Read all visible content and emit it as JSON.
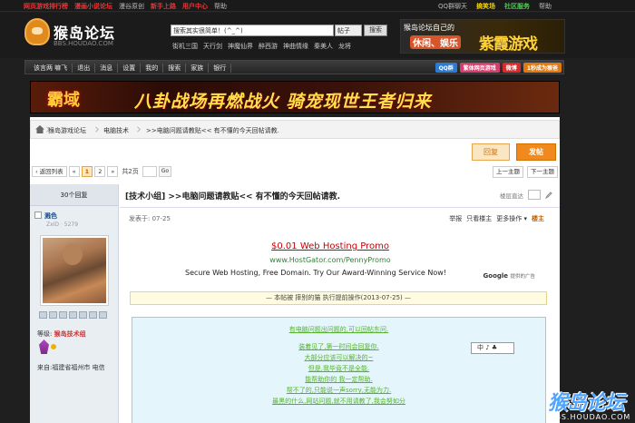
{
  "topbar": {
    "left": [
      "网页游戏排行榜",
      "漫画小说论坛",
      "漫谷原创",
      "新手上路",
      "用户中心",
      "帮助"
    ],
    "right": [
      "QQ群聊天",
      "搞笑场",
      "社区服务",
      "帮助"
    ]
  },
  "header": {
    "logo_name": "猴岛论坛",
    "logo_domain": "BBS.HOUDAO.COM",
    "search_placeholder": "搜索其实很简单！(^_^)",
    "search_scope": "帖子",
    "search_button": "搜索",
    "hot_links": [
      "街机三国",
      "天行剑",
      "神魔仙界",
      "醉西游",
      "神曲情缘",
      "秦美人",
      "龙将"
    ],
    "ad_line1": "猴岛论坛自己的",
    "ad_line2": "休闲、娱乐",
    "ad_brand": "紫霞游戏"
  },
  "nav": {
    "items": [
      "该言两 嘛飞",
      "退出",
      "消息",
      "设置",
      "我的",
      "搜索",
      "家族",
      "银行"
    ],
    "pills": [
      {
        "label": "QQ群",
        "color": "#2a7ad6"
      },
      {
        "label": "繁体网页游戏",
        "color": "#d23f6e"
      },
      {
        "label": "微博",
        "color": "#d92b2b"
      },
      {
        "label": "1秒成为猴爸",
        "color": "#e07a10"
      }
    ]
  },
  "banner": {
    "logo": "霸域",
    "text": "八卦战场再燃战火  骑宠现世王者归来"
  },
  "breadcrumb": [
    "猴岛游戏论坛",
    "电脑技术",
    ">>电脑问题请教贴<< 有不懂的今天回帖请教."
  ],
  "actions": {
    "reply": "回复",
    "post": "发帖"
  },
  "pager": {
    "back": "‹ 返回列表",
    "first": "«",
    "pages": [
      "1",
      "2"
    ],
    "next": "»",
    "total": "共2页",
    "go": "Go",
    "prev_thread": "上一主题",
    "next_thread": "下一主题"
  },
  "side": {
    "reply_count": "30个回复",
    "username": "溅色",
    "uid": "ZxID · 5279",
    "level_label": "等级:",
    "level": "猴岛技术组",
    "from": "来自:福建省福州市 电信"
  },
  "post": {
    "title": "[技术小组] >>电脑问题请教贴<< 有不懂的今天回帖请教.",
    "tools": "楼层直达",
    "posted": "发表于: 07-25",
    "acts": [
      "举报",
      "只看楼主",
      "更多操作 ▾",
      "楼主"
    ]
  },
  "ad": {
    "headline": "$0.01 Web Hosting Promo",
    "url": "www.HostGator.com/PennyPromo",
    "desc": "Secure Web Hosting, Free Domain. Try Our Award-Winning Service Now!",
    "brand": "Google",
    "brand_sub": "提供的广告"
  },
  "notice": "— 本帖被 摔别的猫 执行提前操作(2013-07-25) —",
  "message": [
    "有电脑问题出问题的,可以回帖东问.",
    "装着见了,第一时间会回复你.",
    "大部分应该可以解决的~",
    "但是,我毕竟不是全能.",
    "能帮助你的 我一定帮助.",
    "帮不了的,只能说一声sorry,无能为力.",
    "最黑的什么,网站问题,就不用请教了,我会努如分"
  ],
  "ime": "中 ♪ ♣",
  "watermark": {
    "big": "猴岛论坛",
    "small": "BBS.HOUDAO.COM"
  }
}
